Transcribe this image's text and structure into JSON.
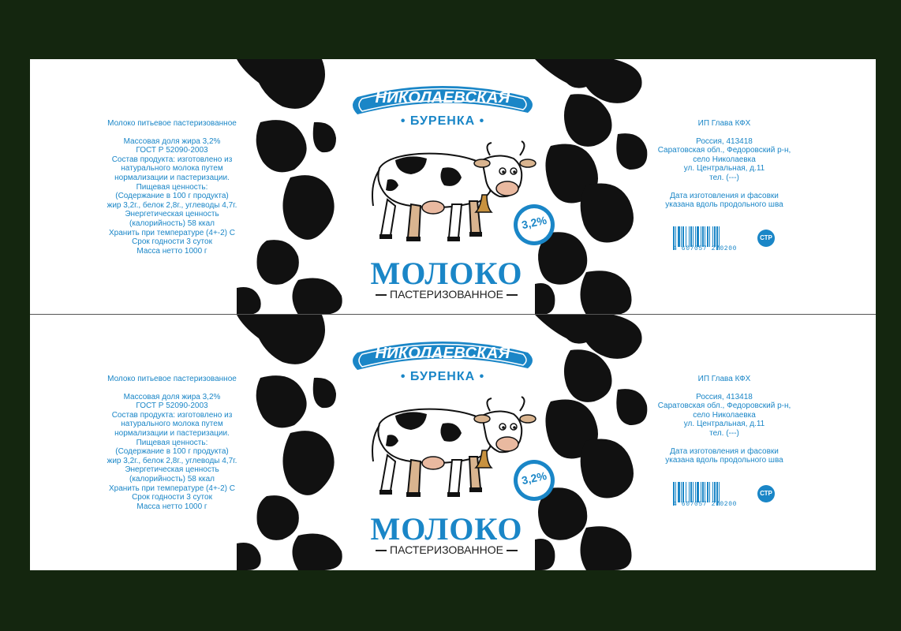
{
  "panels": [
    {
      "brand_line1": "НИКОЛАЕВСКАЯ",
      "brand_line2": "БУРЕНКА",
      "fat_badge": "3,2%",
      "product_name": "МОЛОКО",
      "product_subtitle": "ПАСТЕРИЗОВАННОЕ",
      "left_title": "Молоко питьевое пастеризованное",
      "left_lines": [
        "Массовая доля жира 3,2%",
        "ГОСТ Р 52090-2003",
        "Состав продукта: изготовлено из",
        "натурального молока путем",
        "нормализации и пастеризации.",
        "Пищевая ценность:",
        "(Содержание в 100 г продукта)",
        "жир 3,2г., белок 2,8г., углеводы 4,7г.",
        "Энергетическая ценность",
        "(калорийность) 58 ккал",
        "Хранить при температуре (4+-2) С",
        "Срок годности 3 суток",
        "Масса нетто 1000 г"
      ],
      "right_lines_1": [
        "ИП Глава КФХ"
      ],
      "right_lines_2": [
        "Россия, 413418",
        "Саратовская обл., Федоровский р-н,",
        "село Николаевка",
        "ул. Центральная, д.11",
        "тел. (---)"
      ],
      "right_lines_3": [
        "Дата изготовления и фасовки",
        "указана вдоль продольного шва"
      ],
      "barcode_digits": "4 607057 270200",
      "certification_mark": "СТР"
    },
    {
      "brand_line1": "НИКОЛАЕВСКАЯ",
      "brand_line2": "БУРЕНКА",
      "fat_badge": "3,2%",
      "product_name": "МОЛОКО",
      "product_subtitle": "ПАСТЕРИЗОВАННОЕ",
      "left_title": "Молоко питьевое пастеризованное",
      "left_lines": [
        "Массовая доля жира 3,2%",
        "ГОСТ Р 52090-2003",
        "Состав продукта: изготовлено из",
        "натурального молока путем",
        "нормализации и пастеризации.",
        "Пищевая ценность:",
        "(Содержание в 100 г продукта)",
        "жир 3,2г., белок 2,8г., углеводы 4,7г.",
        "Энергетическая ценность",
        "(калорийность) 58 ккал",
        "Хранить при температуре (4+-2) С",
        "Срок годности 3 суток",
        "Масса нетто 1000 г"
      ],
      "right_lines_1": [
        "ИП Глава КФХ"
      ],
      "right_lines_2": [
        "Россия, 413418",
        "Саратовская обл., Федоровский р-н,",
        "село Николаевка",
        "ул. Центральная, д.11",
        "тел. (---)"
      ],
      "right_lines_3": [
        "Дата изготовления и фасовки",
        "указана вдоль продольного шва"
      ],
      "barcode_digits": "4 607057 270200",
      "certification_mark": "СТР"
    }
  ],
  "colors": {
    "background": "#14260f",
    "accent_blue": "#1a86c7",
    "spots": "#111111"
  }
}
